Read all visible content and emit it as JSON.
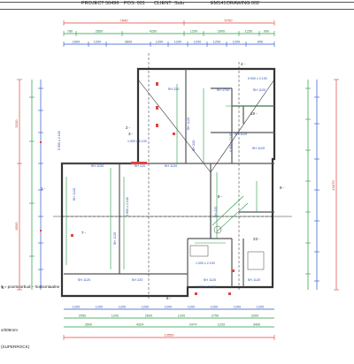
{
  "header": {
    "project": "PROJECT 50496",
    "pos": "POS. 001",
    "client": "CLIENT",
    "client_value": "Sulu",
    "em": "EM141",
    "drawing": "DRAWING 002"
  },
  "dims": {
    "top_red": [
      "7840",
      "5700"
    ],
    "top_green": [
      "780",
      "2850",
      "4260",
      "1200",
      "2900",
      "1250",
      "900"
    ],
    "top_blue": [
      "1600",
      "1200",
      "3600",
      "1200",
      "1200",
      "1200",
      "1200",
      "1200",
      "600"
    ],
    "bottom_blue": [
      "1200",
      "1200",
      "1200",
      "1200",
      "1200",
      "1200",
      "1200",
      "1200",
      "1200"
    ],
    "bottom_green": [
      "2550",
      "1200",
      "2600",
      "1200",
      "2750",
      "2000"
    ],
    "bottom_green2": [
      "3500",
      "4324",
      "2474",
      "1220",
      "3400"
    ],
    "bottom_red": "13550",
    "left_red": [
      "5100",
      "8500"
    ],
    "right_red": "13470"
  },
  "rooms": [
    "SH 220",
    "SH 1720",
    "SH 1120",
    "SH 1120",
    "SH 220",
    "SH 1120",
    "SH 1120",
    "SH 220",
    "SH 1120",
    "SH 220",
    "SH 1120",
    "SH 1120",
    "SH 1120",
    "SH 1120",
    "SH 220",
    "SH 1120",
    "SH 1120"
  ],
  "marks": {
    "window_a": "0.900 x 2.100",
    "window_b": "1.000 x 2.100",
    "window_c": "0.900 x 2.100",
    "window_d": "1.000 x 2.100",
    "window_e": "1.000 x 2.100",
    "window_f": "0.900 x 2.100",
    "window_g": "0.900 x 2.100",
    "section_2": "2 -",
    "section_3": "3 -",
    "section_4": "4 -",
    "section_1": "1 -",
    "section_5": "5 -",
    "section_6": "6 -",
    "section_7": "7 -",
    "section_8": "8 -",
    "section_9": "9 -",
    "room_19": "19 -",
    "room_23": "23 -",
    "level": "2.190"
  },
  "notes": {
    "line1": "5 – poorsoorbud – horisontaalne",
    "line2": "x/005mm",
    "line3": "(SUPERROCK)"
  }
}
